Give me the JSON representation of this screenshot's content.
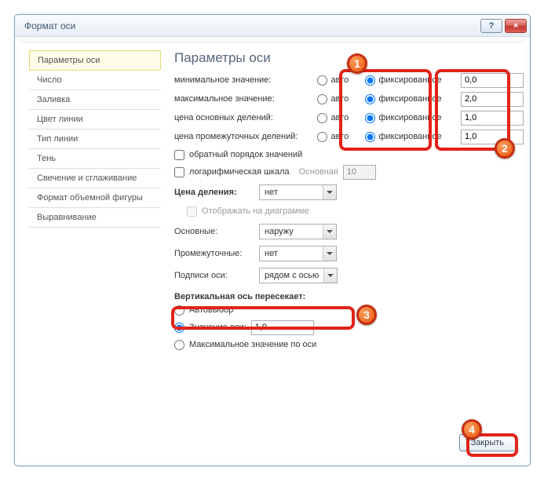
{
  "window": {
    "title": "Формат оси",
    "help_tooltip": "?",
    "close_tooltip": "×"
  },
  "sidebar": {
    "items": [
      "Параметры оси",
      "Число",
      "Заливка",
      "Цвет линии",
      "Тип линии",
      "Тень",
      "Свечение и сглаживание",
      "Формат объемной фигуры",
      "Выравнивание"
    ]
  },
  "main": {
    "heading": "Параметры оси",
    "rows": [
      {
        "label": "минимальное значение:",
        "auto": "авто",
        "fixed": "фиксированное",
        "value": "0,0"
      },
      {
        "label": "максимальное значение:",
        "auto": "авто",
        "fixed": "фиксированное",
        "value": "2,0"
      },
      {
        "label": "цена основных делений:",
        "auto": "авто",
        "fixed": "фиксированное",
        "value": "1,0"
      },
      {
        "label": "цена промежуточных делений:",
        "auto": "авто",
        "fixed": "фиксированное",
        "value": "1,0"
      }
    ],
    "reverse_order": "обратный порядок значений",
    "log_scale": "логарифмическая шкала",
    "log_base_label": "Основная",
    "log_base_value": "10",
    "unit_label": "Цена деления:",
    "unit_value": "нет",
    "show_on_chart": "Отображать на диаграмме",
    "major_label": "Основные:",
    "major_value": "наружу",
    "minor_label": "Промежуточные:",
    "minor_value": "нет",
    "ticklabels_label": "Подписи оси:",
    "ticklabels_value": "рядом с осью",
    "cross_header": "Вертикальная ось пересекает:",
    "cross_auto": "Автовыбор",
    "cross_at_label": "Значение оси:",
    "cross_at_value": "1,0",
    "cross_max": "Максимальное значение по оси",
    "close_btn": "Закрыть"
  },
  "markers": {
    "m1": "1",
    "m2": "2",
    "m3": "3",
    "m4": "4"
  }
}
